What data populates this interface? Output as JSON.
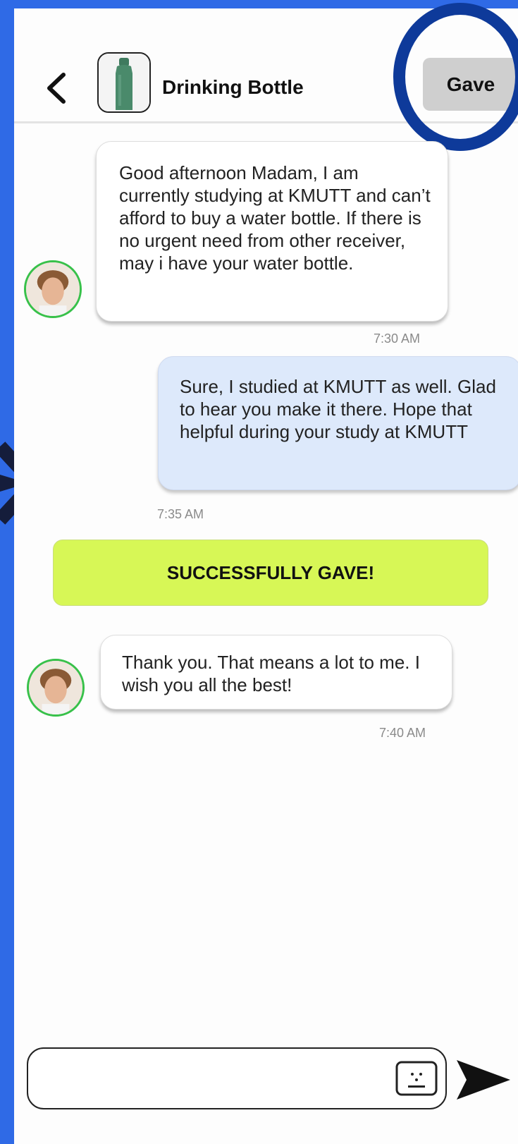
{
  "header": {
    "back_icon": "chevron-left-icon",
    "item_thumbnail_icon": "bottle-icon",
    "title": "Drinking Bottle",
    "gave_label": "Gave"
  },
  "messages": [
    {
      "direction": "incoming",
      "text": "Good afternoon Madam, I am currently studying at KMUTT and can’t afford to buy a water bottle. If there is no urgent need from other receiver, may i have your water bottle.",
      "time": "7:30 AM"
    },
    {
      "direction": "outgoing",
      "text": "Sure, I studied at KMUTT as well. Glad to hear you make it there. Hope that helpful during your study at KMUTT",
      "time": "7:35 AM"
    },
    {
      "direction": "incoming",
      "text": "Thank you. That means a lot to me. I wish you all the best!",
      "time": "7:40 AM"
    }
  ],
  "status_banner": "SUCCESSFULLY GAVE!",
  "composer": {
    "value": "",
    "placeholder": "",
    "keyboard_icon": "keyboard-icon",
    "send_icon": "send-icon"
  },
  "colors": {
    "background": "#2f6ae6",
    "highlight_ring": "#0e3a9a",
    "banner": "#d7f756",
    "outgoing_bubble": "#dde9fb",
    "avatar_border": "#37c14a"
  }
}
